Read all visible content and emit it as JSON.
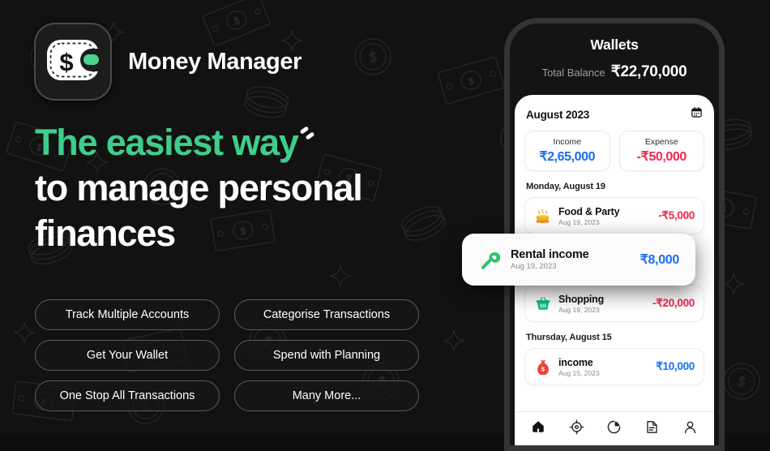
{
  "brand": {
    "app_title": "Money Manager",
    "logo_icon": "wallet-dollar-icon",
    "accent_green": "#3ECE8B"
  },
  "headline": {
    "line1": "The easiest way",
    "line2": "to manage personal",
    "line3": "finances"
  },
  "features": [
    {
      "label": "Track Multiple Accounts"
    },
    {
      "label": "Categorise Transactions"
    },
    {
      "label": "Get Your Wallet"
    },
    {
      "label": "Spend with Planning"
    },
    {
      "label": "One Stop All Transactions"
    },
    {
      "label": "Many More..."
    }
  ],
  "phone": {
    "header": {
      "title": "Wallets",
      "balance_label": "Total Balance",
      "balance_value": "₹22,70,000"
    },
    "month": {
      "label": "August 2023",
      "calendar_icon": "calendar-icon"
    },
    "summary": [
      {
        "label": "Income",
        "value": "₹2,65,000",
        "color": "#1B6EF3"
      },
      {
        "label": "Expense",
        "value": "-₹50,000",
        "color": "#F4264F"
      }
    ],
    "groups": [
      {
        "day": "Monday, August 19",
        "transactions": [
          {
            "name": "Food & Party",
            "date": "Aug 19, 2023",
            "amount": "-₹5,000",
            "type": "expense",
            "icon": "food-bowl-icon"
          }
        ]
      },
      {
        "day": "",
        "transactions": [
          {
            "name": "Shopping",
            "date": "Aug 19, 2023",
            "amount": "-₹20,000",
            "type": "expense",
            "icon": "shopping-basket-icon"
          }
        ]
      },
      {
        "day": "Thursday, August 15",
        "transactions": [
          {
            "name": "income",
            "date": "Aug 15, 2023",
            "amount": "₹10,000",
            "type": "income",
            "icon": "money-bag-icon"
          }
        ]
      }
    ],
    "floating_transaction": {
      "name": "Rental income",
      "date": "Aug 19, 2023",
      "amount": "₹8,000",
      "type": "income",
      "icon": "rental-key-icon"
    },
    "bottom_nav": [
      {
        "icon": "home-icon",
        "active": true
      },
      {
        "icon": "target-icon",
        "active": false
      },
      {
        "icon": "pie-chart-icon",
        "active": false
      },
      {
        "icon": "report-doc-icon",
        "active": false
      },
      {
        "icon": "person-icon",
        "active": false
      }
    ]
  }
}
